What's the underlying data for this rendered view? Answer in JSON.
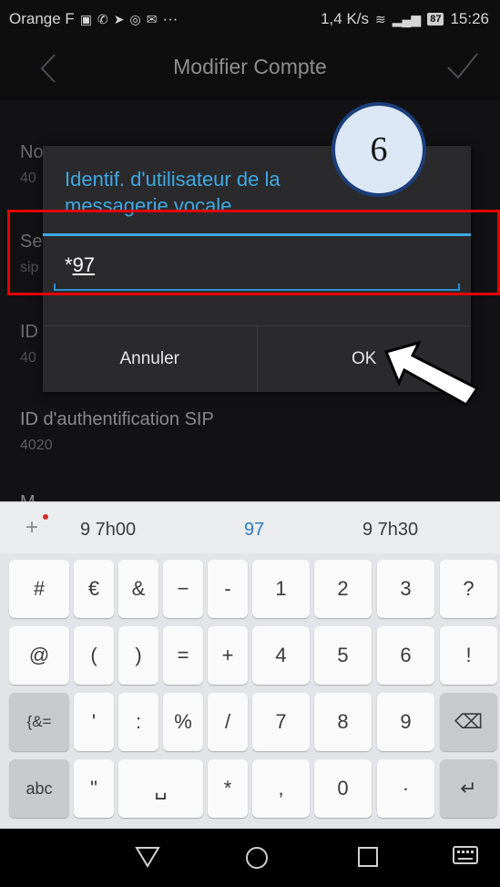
{
  "status_bar": {
    "carrier": "Orange F",
    "net_speed": "1,4 K/s",
    "battery": "87",
    "time": "15:26",
    "extra": "···"
  },
  "appbar": {
    "title": "Modifier Compte"
  },
  "list": [
    {
      "title": "No",
      "sub": "40"
    },
    {
      "title": "Se",
      "sub": "sip"
    },
    {
      "title": "ID",
      "sub": "40"
    },
    {
      "title": "ID d'authentification SIP",
      "sub": "4020"
    },
    {
      "title": "M",
      "sub": ""
    }
  ],
  "dialog": {
    "title": "Identif. d'utilisateur de la messagerie vocale",
    "value_prefix": "*",
    "value_typed": "97",
    "cancel_label": "Annuler",
    "ok_label": "OK"
  },
  "annotation": {
    "step_number": "6"
  },
  "keyboard": {
    "suggestions": [
      "9 7h00",
      "97",
      "9 7h30"
    ],
    "suggest_plus": "+",
    "rows": [
      [
        "#",
        "€",
        "&",
        "−",
        "-",
        "1",
        "2",
        "3",
        "?"
      ],
      [
        "@",
        "(",
        ")",
        "=",
        "+",
        "4",
        "5",
        "6",
        "!"
      ],
      [
        "{&=",
        "'",
        ":",
        "%",
        "/",
        "7",
        "8",
        "9",
        "⌫"
      ],
      [
        "abc",
        "\"",
        "␣",
        "*",
        ",",
        "0",
        "·",
        "↵"
      ]
    ]
  },
  "colors": {
    "accent": "#3fa9e4",
    "annotation_red": "#e30000",
    "badge_border": "#1c3f7a"
  }
}
